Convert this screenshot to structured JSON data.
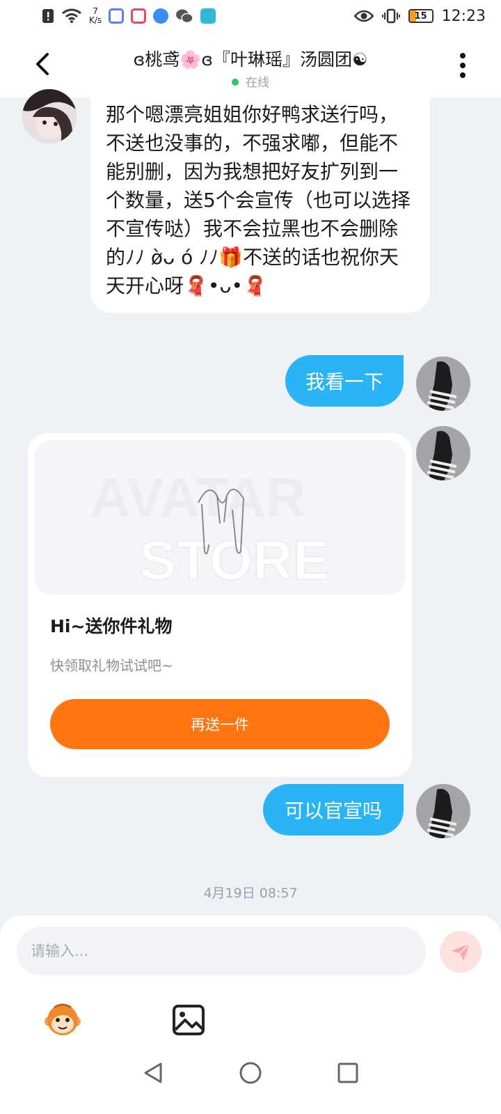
{
  "status_bar": {
    "net_speed_value": "7",
    "net_speed_unit": "K/s",
    "battery_level": "15",
    "time": "12:23"
  },
  "header": {
    "title": "ɞ桃鸢🌸ɞ『叶琳瑶』汤圆团☯",
    "status": "在线"
  },
  "messages": {
    "incoming_text": "那个嗯漂亮姐姐你好鸭求送行吗，不送也没事的，不强求嘟，但能不能别删，因为我想把好友扩列到一个数量，送5个会宣传（也可以选择不宣传哒）我不会拉黑也不会删除的ﾉﾉ ø̀ᴗ ó ﾉﾉ🎁不送的话也祝你天天开心呀🧣•ᴗ•🧣",
    "outgoing_1": "我看一下",
    "outgoing_2": "可以官宣吗"
  },
  "gift_card": {
    "title": "Hi~送你件礼物",
    "subtitle": "快领取礼物试试吧~",
    "button_label": "再送一件"
  },
  "timestamp": "4月19日 08:57",
  "input": {
    "placeholder": "请输入..."
  },
  "colors": {
    "outgoing_bubble": "#2bb4f5",
    "gift_button": "#ff7512",
    "online_dot": "#31c36b",
    "send_button_bg": "#fde2e0"
  },
  "icons": {
    "back": "chevron-left-icon",
    "more": "more-vertical-icon",
    "send": "send-icon",
    "emoji": "monkey-emoji-icon",
    "image": "image-icon"
  }
}
